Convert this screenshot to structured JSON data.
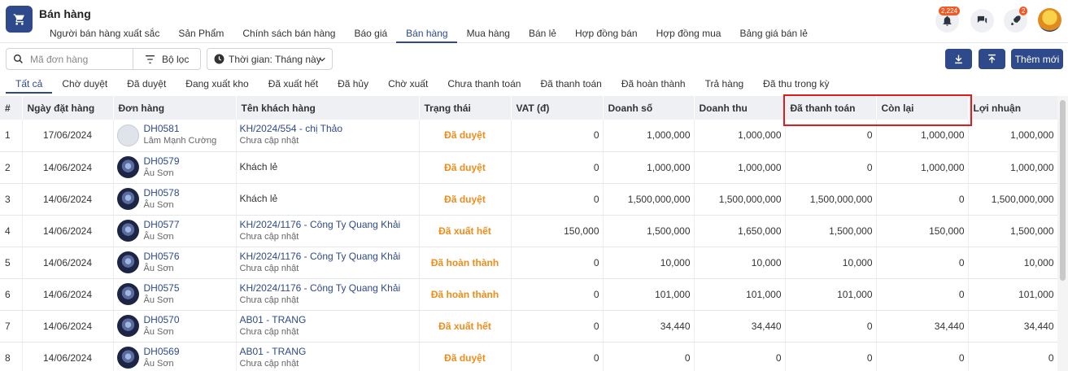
{
  "header": {
    "title": "Bán hàng",
    "module_tabs": [
      "Người bán hàng xuất sắc",
      "Sản Phẩm",
      "Chính sách bán hàng",
      "Báo giá",
      "Bán hàng",
      "Mua hàng",
      "Bán lẻ",
      "Hợp đồng bán",
      "Hợp đồng mua",
      "Bảng giá bán lẻ"
    ],
    "active_module_tab": "Bán hàng",
    "notification_count": "2,224",
    "rocket_count": "2"
  },
  "toolbar": {
    "search_placeholder": "Mã đơn hàng",
    "filter_label": "Bộ lọc",
    "time_label": "Thời gian: Tháng này",
    "add_label": "Thêm mới"
  },
  "status_tabs": [
    "Tất cả",
    "Chờ duyệt",
    "Đã duyệt",
    "Đang xuất kho",
    "Đã xuất hết",
    "Đã hủy",
    "Chờ xuất",
    "Chưa thanh toán",
    "Đã thanh toán",
    "Đã hoàn thành",
    "Trả hàng",
    "Đã thu trong kỳ"
  ],
  "active_status_tab": "Tất cả",
  "table": {
    "columns": [
      "#",
      "Ngày đặt hàng",
      "Đơn hàng",
      "Tên khách hàng",
      "Trạng thái",
      "VAT (đ)",
      "Doanh số",
      "Doanh thu",
      "Đã thanh toán",
      "Còn lại",
      "Lợi nhuận"
    ],
    "rows": [
      {
        "idx": "1",
        "date": "17/06/2024",
        "order": "DH0581",
        "seller": "Lâm Mạnh Cường",
        "avatar": "placeholder",
        "customer": "KH/2024/554 - chị Thảo",
        "customer_sub": "Chưa cập nhật",
        "status": "Đã duyệt",
        "vat": "0",
        "sales": "1,000,000",
        "revenue": "1,000,000",
        "paid": "0",
        "remaining": "1,000,000",
        "profit": "1,000,000"
      },
      {
        "idx": "2",
        "date": "14/06/2024",
        "order": "DH0579",
        "seller": "Âu Sơn",
        "avatar": "img",
        "customer": "Khách lẻ",
        "customer_sub": "",
        "status": "Đã duyệt",
        "vat": "0",
        "sales": "1,000,000",
        "revenue": "1,000,000",
        "paid": "0",
        "remaining": "1,000,000",
        "profit": "1,000,000"
      },
      {
        "idx": "3",
        "date": "14/06/2024",
        "order": "DH0578",
        "seller": "Âu Sơn",
        "avatar": "img",
        "customer": "Khách lẻ",
        "customer_sub": "",
        "status": "Đã duyệt",
        "vat": "0",
        "sales": "1,500,000,000",
        "revenue": "1,500,000,000",
        "paid": "1,500,000,000",
        "remaining": "0",
        "profit": "1,500,000,000"
      },
      {
        "idx": "4",
        "date": "14/06/2024",
        "order": "DH0577",
        "seller": "Âu Sơn",
        "avatar": "img",
        "customer": "KH/2024/1176 - Công Ty Quang Khải",
        "customer_sub": "Chưa cập nhật",
        "status": "Đã xuất hết",
        "vat": "150,000",
        "sales": "1,500,000",
        "revenue": "1,650,000",
        "paid": "1,500,000",
        "remaining": "150,000",
        "profit": "1,500,000"
      },
      {
        "idx": "5",
        "date": "14/06/2024",
        "order": "DH0576",
        "seller": "Âu Sơn",
        "avatar": "img",
        "customer": "KH/2024/1176 - Công Ty Quang Khải",
        "customer_sub": "Chưa cập nhật",
        "status": "Đã hoàn thành",
        "vat": "0",
        "sales": "10,000",
        "revenue": "10,000",
        "paid": "10,000",
        "remaining": "0",
        "profit": "10,000"
      },
      {
        "idx": "6",
        "date": "14/06/2024",
        "order": "DH0575",
        "seller": "Âu Sơn",
        "avatar": "img",
        "customer": "KH/2024/1176 - Công Ty Quang Khải",
        "customer_sub": "Chưa cập nhật",
        "status": "Đã hoàn thành",
        "vat": "0",
        "sales": "101,000",
        "revenue": "101,000",
        "paid": "101,000",
        "remaining": "0",
        "profit": "101,000"
      },
      {
        "idx": "7",
        "date": "14/06/2024",
        "order": "DH0570",
        "seller": "Âu Sơn",
        "avatar": "img",
        "customer": "AB01 - TRANG",
        "customer_sub": "Chưa cập nhật",
        "status": "Đã xuất hết",
        "vat": "0",
        "sales": "34,440",
        "revenue": "34,440",
        "paid": "0",
        "remaining": "34,440",
        "profit": "34,440"
      },
      {
        "idx": "8",
        "date": "14/06/2024",
        "order": "DH0569",
        "seller": "Âu Sơn",
        "avatar": "img",
        "customer": "AB01 - TRANG",
        "customer_sub": "Chưa cập nhật",
        "status": "Đã duyệt",
        "vat": "0",
        "sales": "0",
        "revenue": "0",
        "paid": "0",
        "remaining": "0",
        "profit": "0"
      }
    ]
  },
  "colors": {
    "primary": "#2e4a8b",
    "status_orange": "#f08c1a",
    "highlight_red": "#e01b1b"
  }
}
